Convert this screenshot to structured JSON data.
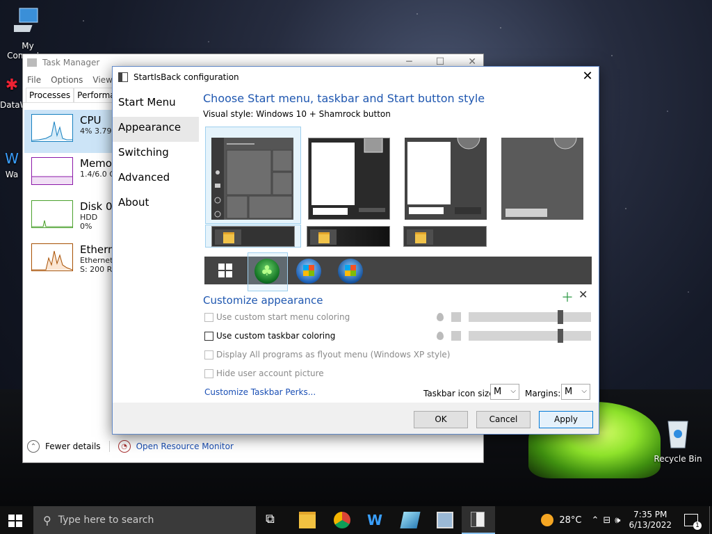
{
  "desktop": {
    "icons": [
      {
        "label": "My Computer"
      },
      {
        "label": "DataW"
      },
      {
        "label": "Wa"
      },
      {
        "label": "Recycle Bin"
      }
    ]
  },
  "task_manager": {
    "title": "Task Manager",
    "menu": [
      "File",
      "Options",
      "View"
    ],
    "tabs": [
      "Processes",
      "Performance"
    ],
    "items": [
      {
        "name": "CPU",
        "sub1": "4%  3.79",
        "sub2": ""
      },
      {
        "name": "Memo",
        "sub1": "1.4/6.0 G",
        "sub2": ""
      },
      {
        "name": "Disk 0",
        "sub1": "HDD",
        "sub2": "0%"
      },
      {
        "name": "Ethern",
        "sub1": "Ethernet",
        "sub2": "S: 200 R"
      }
    ],
    "fewer_details": "Fewer details",
    "open_resource_monitor": "Open Resource Monitor"
  },
  "dialog": {
    "title": "StartIsBack configuration",
    "nav": [
      "Start Menu",
      "Appearance",
      "Switching",
      "Advanced",
      "About"
    ],
    "heading": "Choose Start menu, taskbar and Start button style",
    "visual_style_label": "Visual style:",
    "visual_style_value": "Windows 10 + Shamrock button",
    "customize_heading": "Customize appearance",
    "checkboxes": [
      {
        "label": "Use custom start menu coloring",
        "checked": false,
        "enabled": false
      },
      {
        "label": "Use custom taskbar coloring",
        "checked": false,
        "enabled": true
      },
      {
        "label": "Display All programs as flyout menu (Windows XP style)",
        "checked": false,
        "enabled": false
      },
      {
        "label": "Hide user account picture",
        "checked": false,
        "enabled": false
      }
    ],
    "perks_link": "Customize Taskbar Perks...",
    "icon_size_label": "Taskbar icon size:",
    "icon_size_value": "M",
    "margins_label": "Margins:",
    "margins_value": "M",
    "buttons": {
      "ok": "OK",
      "cancel": "Cancel",
      "apply": "Apply"
    },
    "colors": {
      "accent": "#1f57b0",
      "link": "#1a4fb5"
    }
  },
  "taskbar": {
    "search_placeholder": "Type here to search",
    "weather": "28°C",
    "time": "7:35 PM",
    "date": "6/13/2022",
    "notification_count": "1"
  }
}
